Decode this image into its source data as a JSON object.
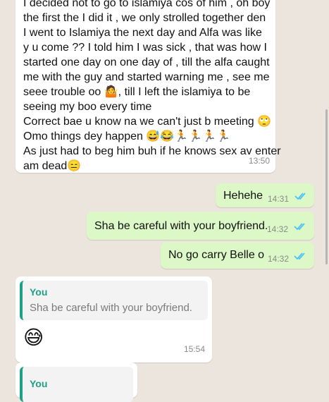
{
  "messages": {
    "m1": {
      "lines": [
        "I decided not to go to islamiya cos of him , oh boy",
        "the first the I did it , we only strolled together den",
        "I went to Islamiya the next day and Alfa was like",
        "y u come ?? I told him I was sick , that was how I",
        "started one day on one day of , till the alfa caught",
        "me with the guy and started warning me , see me",
        "seee trouble oo 🤷, till I left the islamiya to be",
        "seeing my boo every time",
        "Correct bae u know na we can't just b meeting 🙄",
        "Omo things dey happen 😅😂🏃🏃🏃🏃",
        "As just had to beg him buh if he knows sex av enter",
        "am dead😑"
      ],
      "time": "13:50"
    },
    "m2": {
      "text": "Hehehe",
      "time": "14:31"
    },
    "m3": {
      "text": "Sha be careful with your boyfriend.",
      "time": "14:32"
    },
    "m4": {
      "text": "No go carry Belle o",
      "time": "14:32"
    },
    "m5": {
      "quote_name": "You",
      "quote_text": "Sha be careful with your boyfriend.",
      "emoji": "😅",
      "time": "15:54"
    },
    "m6": {
      "quote_name": "You"
    }
  },
  "colors": {
    "background": "#ece5dd",
    "incoming": "#ffffff",
    "outgoing": "#dcf8c6",
    "read_ticks": "#4fc3f7",
    "quote_accent": "#1fa085"
  },
  "icons": {
    "read_receipt": "double-check-icon"
  }
}
